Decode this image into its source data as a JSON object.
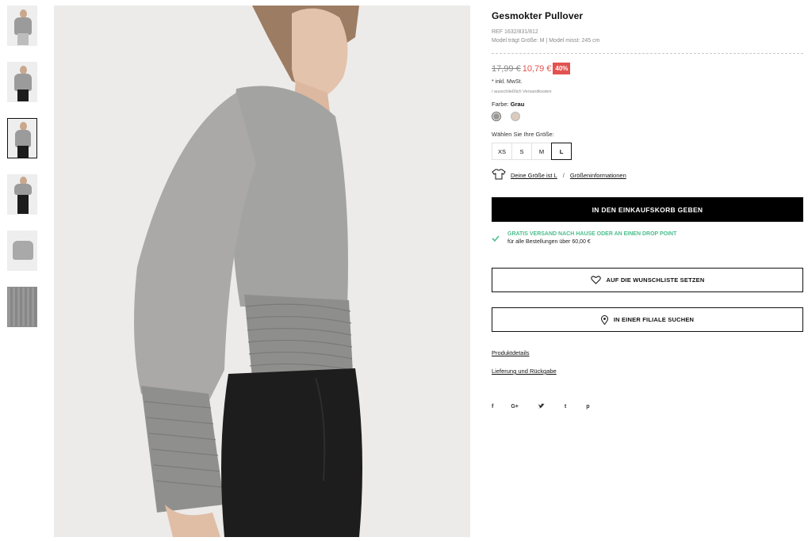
{
  "product": {
    "title": "Gesmokter Pullover",
    "ref": "REF 1632/831/812",
    "model_info": "Model trägt Größe: M | Model misst: 245 cm",
    "old_price": "17,99 €",
    "new_price": "10,79 €",
    "discount": "40%",
    "tax_note": "* inkl. MwSt.",
    "shipping_note": "/ ausschließlich Versandkosten"
  },
  "colors": {
    "label": "Farbe:",
    "selected_name": "Grau",
    "swatches": [
      {
        "name": "Grau",
        "hex": "#9a9794"
      },
      {
        "name": "Beige",
        "hex": "#d9cbbd"
      }
    ]
  },
  "sizes": {
    "label": "Wählen Sie Ihre Größe:",
    "options": [
      "XS",
      "S",
      "M",
      "L"
    ],
    "selected": "L"
  },
  "size_links": {
    "your_size": "Deine Größe ist L",
    "separator": "/",
    "size_info": "Größeninformationen"
  },
  "actions": {
    "add_to_cart": "IN DEN EINKAUFSKORB GEBEN",
    "wishlist": "AUF DIE WUNSCHLISTE SETZEN",
    "find_store": "IN EINER FILIALE SUCHEN"
  },
  "free_shipping": {
    "line1": "GRATIS VERSAND NACH HAUSE ODER AN EINEN DROP POINT",
    "line2": "für alle Bestellungen über 60,00 €",
    "accent": "#4cbe8c"
  },
  "links": {
    "details": "Produktdetails",
    "delivery": "Lieferung und Rückgabe"
  },
  "socials": [
    "f",
    "G+",
    "twitter-icon",
    "t",
    "p"
  ],
  "colors_theme": {
    "sale_red": "#e2534f",
    "button_black": "#000000"
  }
}
